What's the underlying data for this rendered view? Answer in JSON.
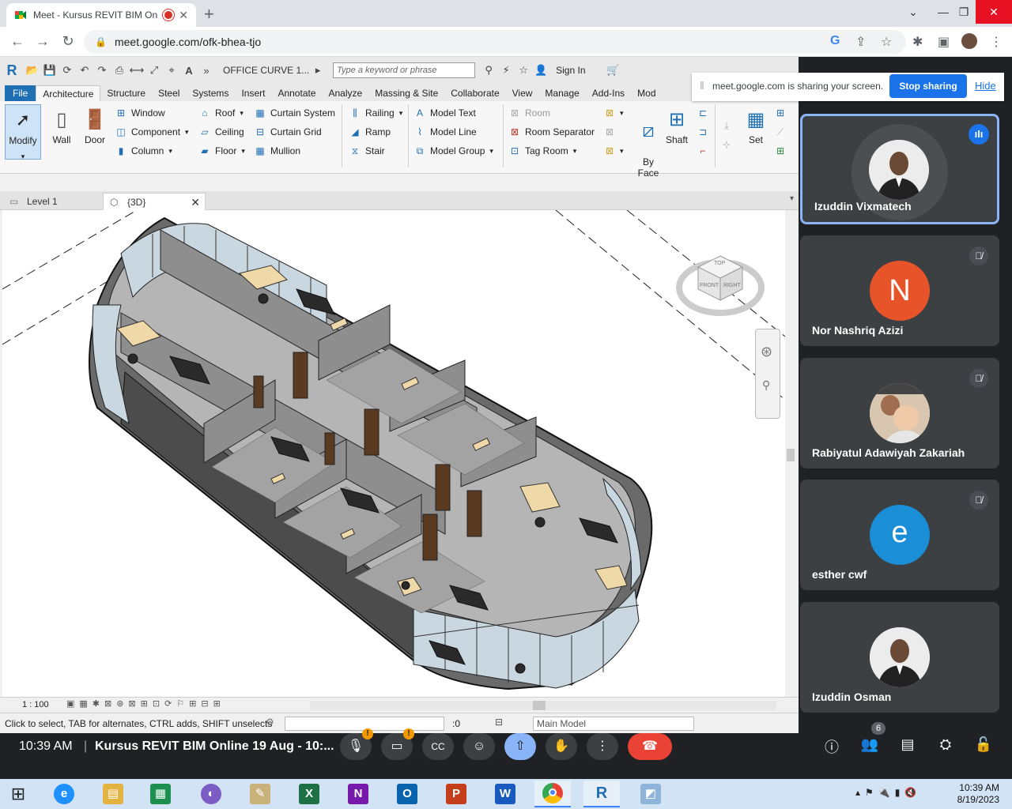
{
  "browser": {
    "tab_title": "Meet - Kursus REVIT BIM Onl",
    "new_tab": "+",
    "url": "meet.google.com/ofk-bhea-tjo"
  },
  "revit": {
    "doc_title": "OFFICE CURVE 1...",
    "search_placeholder": "Type a keyword or phrase",
    "sign_in": "Sign In",
    "tabs": [
      "File",
      "Architecture",
      "Structure",
      "Steel",
      "Systems",
      "Insert",
      "Annotate",
      "Analyze",
      "Massing & Site",
      "Collaborate",
      "View",
      "Manage",
      "Add-Ins",
      "Mod"
    ],
    "active_tab": "Architecture",
    "ribbon": {
      "modify": "Modify",
      "wall": "Wall",
      "door": "Door",
      "window": "Window",
      "component": "Component",
      "column": "Column",
      "roof": "Roof",
      "ceiling": "Ceiling",
      "floor": "Floor",
      "curtain_system": "Curtain System",
      "curtain_grid": "Curtain Grid",
      "mullion": "Mullion",
      "railing": "Railing",
      "ramp": "Ramp",
      "stair": "Stair",
      "model_text": "Model  Text",
      "model_line": "Model  Line",
      "model_group": "Model  Group",
      "room": "Room",
      "room_separator": "Room  Separator",
      "tag_room": "Tag  Room",
      "by_face": "By\nFace",
      "shaft": "Shaft",
      "set": "Set"
    },
    "view_tabs": [
      "Level 1",
      "{3D}"
    ],
    "scale": "1 : 100",
    "status_text": "Click to select, TAB for alternates, CTRL adds, SHIFT unselects",
    "selection_count": ":0",
    "model": "Main Model",
    "viewcube": {
      "top": "TOP",
      "front": "FRONT",
      "right": "RIGHT"
    }
  },
  "share_banner": {
    "text": "meet.google.com is sharing your screen.",
    "stop": "Stop sharing",
    "hide": "Hide"
  },
  "participants": [
    {
      "name": "Izuddin Vixmatech",
      "type": "photo",
      "speaking": true
    },
    {
      "name": "Nor Nashriq Azizi",
      "type": "letter",
      "letter": "N",
      "color": "#e8542a",
      "muted": true
    },
    {
      "name": "Rabiyatul Adawiyah Zakariah",
      "type": "photo",
      "muted": true
    },
    {
      "name": "esther cwf",
      "type": "letter",
      "letter": "e",
      "color": "#1a8ed6",
      "muted": true
    },
    {
      "name": "Izuddin Osman",
      "type": "photo",
      "muted": false
    }
  ],
  "meet": {
    "time": "10:39 AM",
    "separator": "|",
    "title": "Kursus REVIT BIM Online 19 Aug - 10:...",
    "people_count": "6",
    "colors": {
      "end_call": "#ea4335",
      "present": "#8ab4f8"
    }
  },
  "taskbar": {
    "time": "10:39 AM",
    "date": "8/19/2023"
  }
}
